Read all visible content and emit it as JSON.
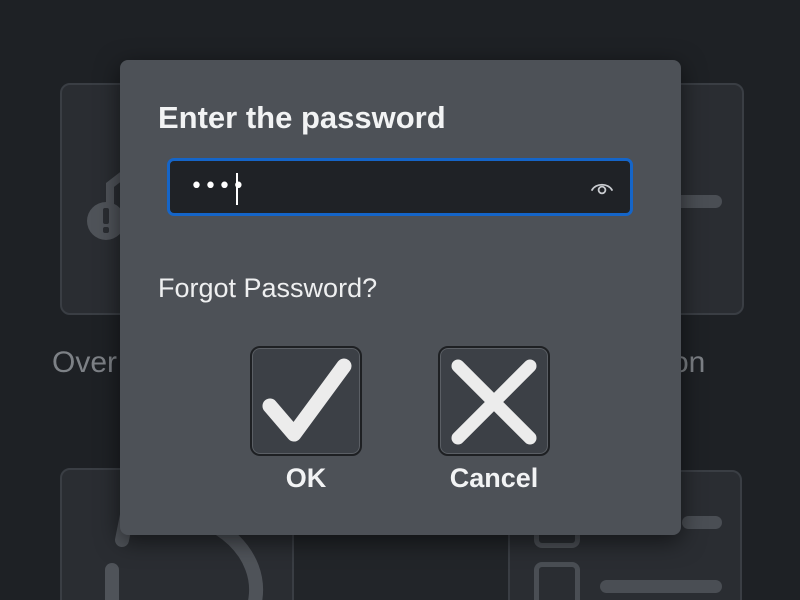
{
  "background": {
    "tiles": [
      {
        "label": "Over"
      },
      {
        "label": "on"
      }
    ]
  },
  "dialog": {
    "title": "Enter the password",
    "password": {
      "masked_value": "••••",
      "reveal_icon": "eye-icon"
    },
    "forgot_link": "Forgot Password?",
    "ok": {
      "label": "OK",
      "icon": "checkmark-icon"
    },
    "cancel": {
      "label": "Cancel",
      "icon": "x-icon"
    }
  },
  "colors": {
    "dialog_bg": "#4d5157",
    "input_border": "#1565c8",
    "background": "#1e2125"
  }
}
